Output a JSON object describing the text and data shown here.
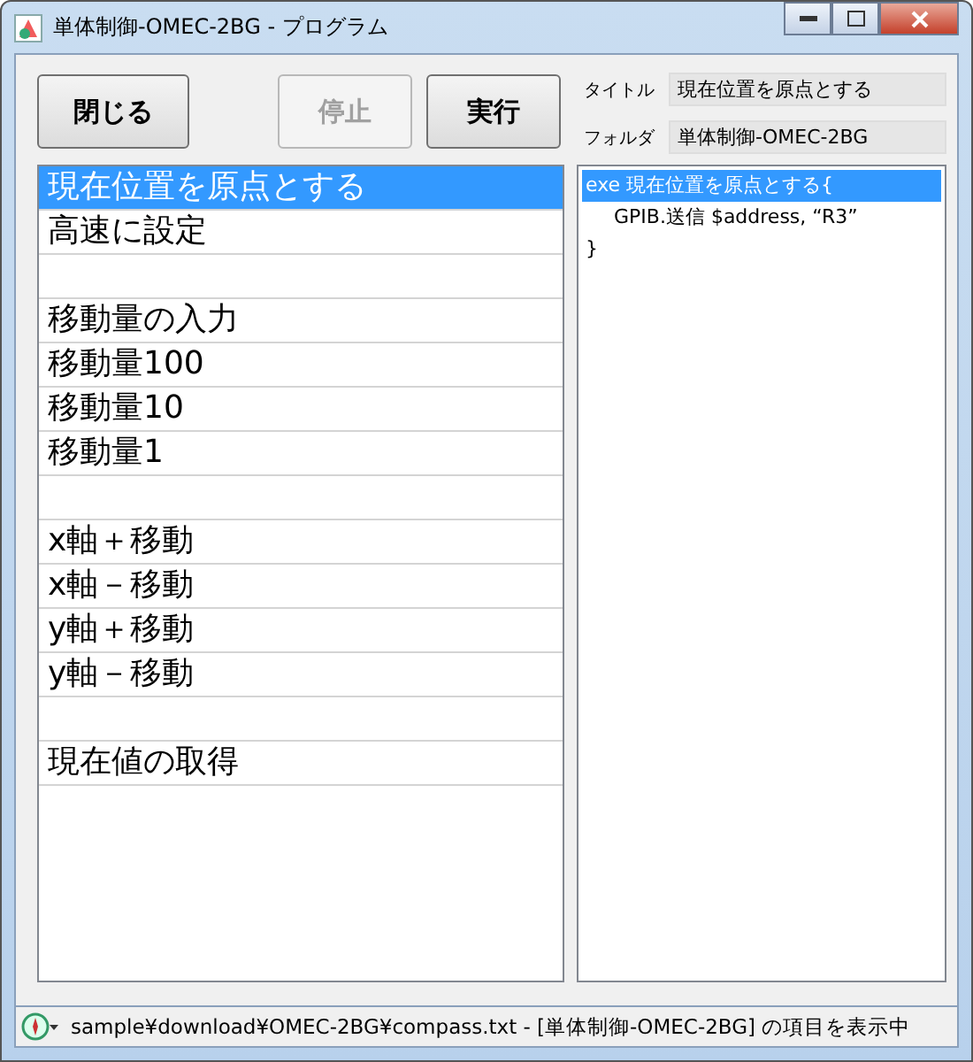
{
  "window": {
    "title": "単体制御-OMEC-2BG - プログラム"
  },
  "buttons": [
    {
      "label": "閉じる",
      "disabled": false
    },
    {
      "label": "停止",
      "disabled": true
    },
    {
      "label": "実行",
      "disabled": false
    }
  ],
  "fields": [
    {
      "label": "タイトル",
      "value": "現在位置を原点とする"
    },
    {
      "label": "フォルダ",
      "value": "単体制御-OMEC-2BG"
    }
  ],
  "list": [
    {
      "kind": "item",
      "label": "現在位置を原点とする",
      "selected": true
    },
    {
      "kind": "item",
      "label": "高速に設定",
      "selected": false
    },
    {
      "kind": "blank",
      "selected": false
    },
    {
      "kind": "item",
      "label": "移動量の入力",
      "selected": false
    },
    {
      "kind": "item",
      "label": "移動量100",
      "selected": false
    },
    {
      "kind": "item",
      "label": "移動量10",
      "selected": false
    },
    {
      "kind": "item",
      "label": "移動量1",
      "selected": false
    },
    {
      "kind": "blank",
      "selected": false
    },
    {
      "kind": "item",
      "label": "x軸＋移動",
      "selected": false
    },
    {
      "kind": "item",
      "label": "x軸－移動",
      "selected": false
    },
    {
      "kind": "item",
      "label": "y軸＋移動",
      "selected": false
    },
    {
      "kind": "item",
      "label": "y軸－移動",
      "selected": false
    },
    {
      "kind": "blank",
      "selected": false
    },
    {
      "kind": "item",
      "label": "現在値の取得",
      "selected": false
    }
  ],
  "code": [
    {
      "text": "exe 現在位置を原点とする{",
      "selected": true,
      "indent": false
    },
    {
      "text": "GPIB.送信 $address, “R3”",
      "selected": false,
      "indent": true
    },
    {
      "text": "}",
      "selected": false,
      "indent": false
    }
  ],
  "status_bar": {
    "text": "sample¥download¥OMEC-2BG¥compass.txt - [単体制御-OMEC-2BG] の項目を表示中"
  }
}
